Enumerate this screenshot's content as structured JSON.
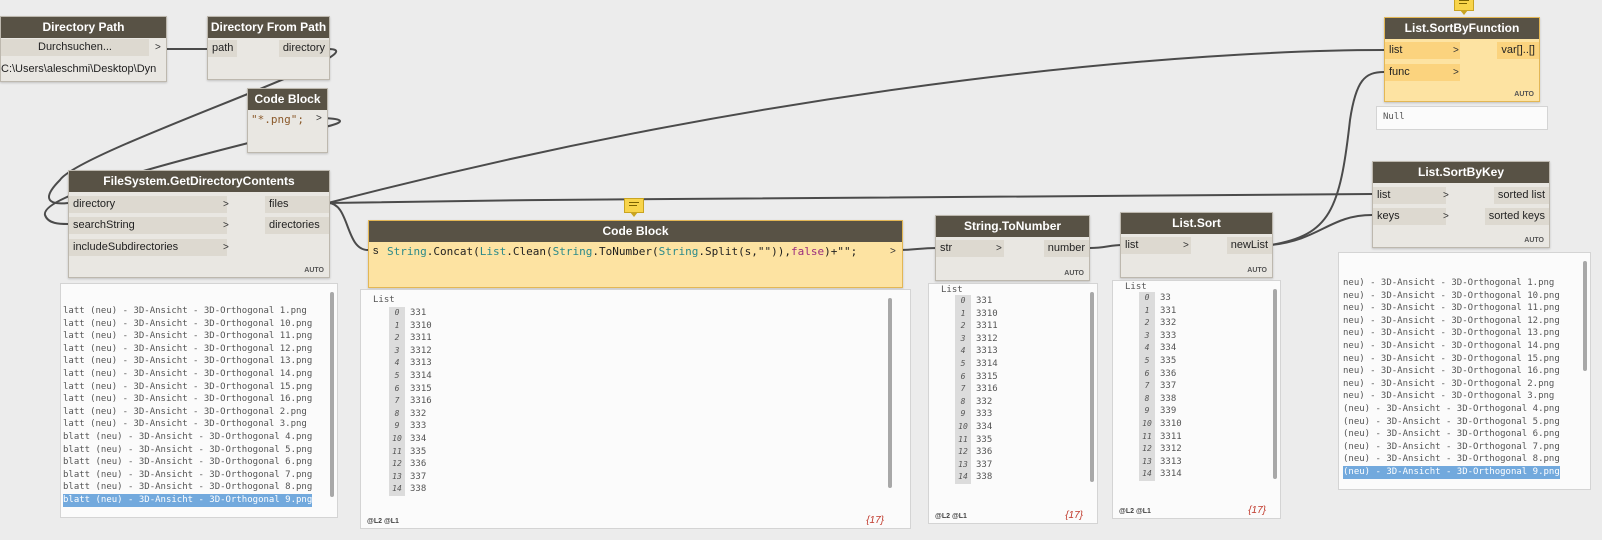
{
  "dir_path": {
    "title": "Directory Path",
    "browse": "Durchsuchen...",
    "browse_arrow": ">",
    "value": "C:\\Users\\aleschmi\\Desktop\\Dyn"
  },
  "dir_from_path": {
    "title": "Directory From Path",
    "in": "path",
    "out": "directory"
  },
  "cb1": {
    "title": "Code Block",
    "code": "\"*.png\";",
    "arrow": ">"
  },
  "fs": {
    "title": "FileSystem.GetDirectoryContents",
    "in1": "directory",
    "in2": "searchString",
    "in3": "includeSubdirectories",
    "out1": "files",
    "out2": "directories",
    "auto": "AUTO"
  },
  "fs_preview": {
    "rows": [
      "latt (neu) - 3D-Ansicht - 3D-Orthogonal 1.png",
      "latt (neu) - 3D-Ansicht - 3D-Orthogonal 10.png",
      "latt (neu) - 3D-Ansicht - 3D-Orthogonal 11.png",
      "latt (neu) - 3D-Ansicht - 3D-Orthogonal 12.png",
      "latt (neu) - 3D-Ansicht - 3D-Orthogonal 13.png",
      "latt (neu) - 3D-Ansicht - 3D-Orthogonal 14.png",
      "latt (neu) - 3D-Ansicht - 3D-Orthogonal 15.png",
      "latt (neu) - 3D-Ansicht - 3D-Orthogonal 16.png",
      "latt (neu) - 3D-Ansicht - 3D-Orthogonal 2.png",
      "latt (neu) - 3D-Ansicht - 3D-Orthogonal 3.png",
      "blatt (neu) - 3D-Ansicht - 3D-Orthogonal 4.png",
      "blatt (neu) - 3D-Ansicht - 3D-Orthogonal 5.png",
      "blatt (neu) - 3D-Ansicht - 3D-Orthogonal 6.png",
      "blatt (neu) - 3D-Ansicht - 3D-Orthogonal 7.png",
      "blatt (neu) - 3D-Ansicht - 3D-Orthogonal 8.png",
      "blatt (neu) - 3D-Ansicht - 3D-Orthogonal 9.png"
    ]
  },
  "cb2": {
    "title": "Code Block",
    "port": "s",
    "arrow": ">",
    "tokens": [
      [
        "String",
        "c-cls"
      ],
      [
        ".Concat(",
        ""
      ],
      [
        "List",
        "c-cls"
      ],
      [
        ".Clean(",
        ""
      ],
      [
        "String",
        "c-cls"
      ],
      [
        ".ToNumber(",
        ""
      ],
      [
        "String",
        "c-cls"
      ],
      [
        ".Split(s,\"\")),",
        ""
      ],
      [
        "false",
        "c-kw"
      ],
      [
        ")+\"\";",
        ""
      ]
    ]
  },
  "cb2_preview": {
    "head": "List",
    "idx": [
      "0",
      "1",
      "2",
      "3",
      "4",
      "5",
      "6",
      "7",
      "8",
      "9",
      "10",
      "11",
      "12",
      "13",
      "14"
    ],
    "vals": [
      "331",
      "3310",
      "3311",
      "3312",
      "3313",
      "3314",
      "3315",
      "3316",
      "332",
      "333",
      "334",
      "335",
      "336",
      "337",
      "338"
    ],
    "levels": "@L2 @L1",
    "count": "{17}"
  },
  "tonum": {
    "title": "String.ToNumber",
    "in": "str",
    "out": "number",
    "auto": "AUTO"
  },
  "tonum_preview": {
    "head": "List",
    "idx": [
      "0",
      "1",
      "2",
      "3",
      "4",
      "5",
      "6",
      "7",
      "8",
      "9",
      "10",
      "11",
      "12",
      "13",
      "14"
    ],
    "vals": [
      "331",
      "3310",
      "3311",
      "3312",
      "3313",
      "3314",
      "3315",
      "3316",
      "332",
      "333",
      "334",
      "335",
      "336",
      "337",
      "338"
    ],
    "levels": "@L2 @L1",
    "count": "{17}"
  },
  "sort": {
    "title": "List.Sort",
    "in": "list",
    "out": "newList",
    "auto": "AUTO"
  },
  "sort_preview": {
    "head": "List",
    "idx": [
      "0",
      "1",
      "2",
      "3",
      "4",
      "5",
      "6",
      "7",
      "8",
      "9",
      "10",
      "11",
      "12",
      "13",
      "14"
    ],
    "vals": [
      "33",
      "331",
      "332",
      "333",
      "334",
      "335",
      "336",
      "337",
      "338",
      "339",
      "3310",
      "3311",
      "3312",
      "3313",
      "3314"
    ],
    "levels": "@L2 @L1",
    "count": "{17}"
  },
  "sbf": {
    "title": "List.SortByFunction",
    "in1": "list",
    "in2": "func",
    "out": "var[]..[]",
    "auto": "AUTO",
    "preview": "Null"
  },
  "sbk": {
    "title": "List.SortByKey",
    "in1": "list",
    "in2": "keys",
    "out1": "sorted list",
    "out2": "sorted keys",
    "auto": "AUTO"
  },
  "sbk_preview": {
    "rows": [
      "neu) - 3D-Ansicht - 3D-Orthogonal 1.png",
      "neu) - 3D-Ansicht - 3D-Orthogonal 10.png",
      "neu) - 3D-Ansicht - 3D-Orthogonal 11.png",
      "neu) - 3D-Ansicht - 3D-Orthogonal 12.png",
      "neu) - 3D-Ansicht - 3D-Orthogonal 13.png",
      "neu) - 3D-Ansicht - 3D-Orthogonal 14.png",
      "neu) - 3D-Ansicht - 3D-Orthogonal 15.png",
      "neu) - 3D-Ansicht - 3D-Orthogonal 16.png",
      "neu) - 3D-Ansicht - 3D-Orthogonal 2.png",
      "neu) - 3D-Ansicht - 3D-Orthogonal 3.png",
      "(neu) - 3D-Ansicht - 3D-Orthogonal 4.png",
      "(neu) - 3D-Ansicht - 3D-Orthogonal 5.png",
      "(neu) - 3D-Ansicht - 3D-Orthogonal 6.png",
      "(neu) - 3D-Ansicht - 3D-Orthogonal 7.png",
      "(neu) - 3D-Ansicht - 3D-Orthogonal 8.png",
      "(neu) - 3D-Ansicht - 3D-Orthogonal 9.png"
    ]
  }
}
